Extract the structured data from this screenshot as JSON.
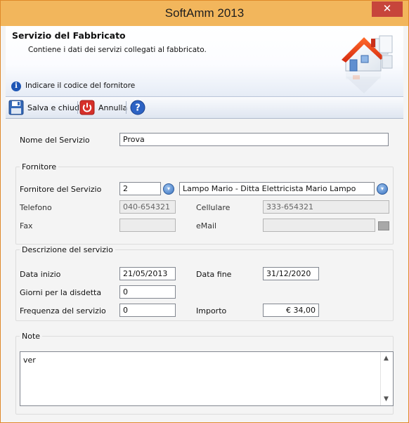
{
  "window": {
    "title": "SoftAmm 2013",
    "close_glyph": "✕"
  },
  "header": {
    "title": "Servizio del Fabbricato",
    "subtitle": "Contiene i dati dei servizi collegati al fabbricato.",
    "info": "Indicare il codice del fornitore",
    "info_icon": "info-icon"
  },
  "toolbar": {
    "save_label": "Salva e chiudi",
    "cancel_label": "Annulla",
    "help_glyph": "?"
  },
  "form": {
    "nome_label": "Nome del Servizio",
    "nome_value": "Prova",
    "fornitore": {
      "legend": "Fornitore",
      "codice_label": "Fornitore del Servizio",
      "codice_value": "2",
      "nome_value": "Lampo Mario - Ditta Elettricista Mario Lampo",
      "telefono_label": "Telefono",
      "telefono_value": "040-654321",
      "cellulare_label": "Cellulare",
      "cellulare_value": "333-654321",
      "fax_label": "Fax",
      "fax_value": "",
      "email_label": "eMail",
      "email_value": ""
    },
    "descrizione": {
      "legend": "Descrizione del servizio",
      "data_inizio_label": "Data inizio",
      "data_inizio_value": "21/05/2013",
      "data_fine_label": "Data fine",
      "data_fine_value": "31/12/2020",
      "giorni_label": "Giorni per la disdetta",
      "giorni_value": "0",
      "frequenza_label": "Frequenza del servizio",
      "frequenza_value": "0",
      "importo_label": "Importo",
      "importo_value": "€ 34,00"
    },
    "note": {
      "legend": "Note",
      "value": "ver"
    }
  },
  "colors": {
    "titlebar": "#f2b65c",
    "close_button": "#c7453b",
    "accent_blue": "#3a73c0"
  }
}
